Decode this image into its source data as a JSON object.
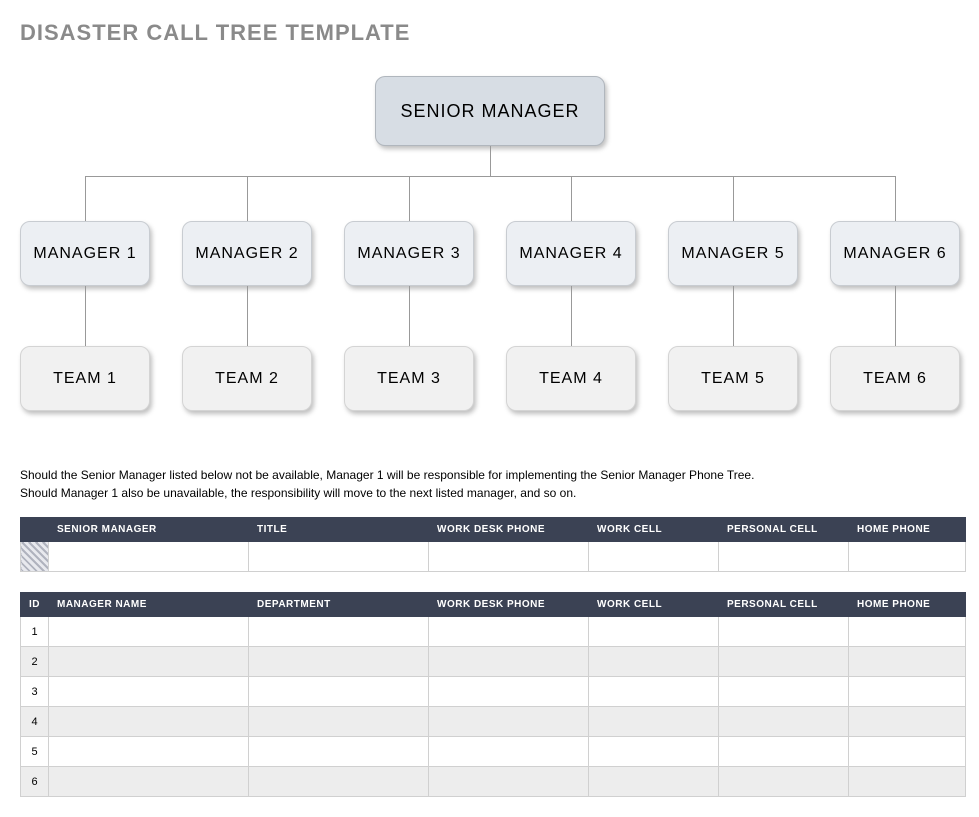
{
  "title": "DISASTER CALL TREE TEMPLATE",
  "tree": {
    "root": "SENIOR MANAGER",
    "managers": [
      "MANAGER 1",
      "MANAGER 2",
      "MANAGER 3",
      "MANAGER 4",
      "MANAGER 5",
      "MANAGER 6"
    ],
    "teams": [
      "TEAM 1",
      "TEAM 2",
      "TEAM 3",
      "TEAM 4",
      "TEAM 5",
      "TEAM 6"
    ]
  },
  "instructions": {
    "line1": "Should the Senior Manager listed below not be available, Manager 1 will be responsible for implementing the Senior Manager Phone Tree.",
    "line2": "Should Manager 1 also be unavailable, the responsibility will move to the next listed manager, and so on."
  },
  "senior_table": {
    "headers": [
      "SENIOR MANAGER",
      "TITLE",
      "WORK DESK PHONE",
      "WORK CELL",
      "PERSONAL CELL",
      "HOME PHONE"
    ],
    "row": [
      "",
      "",
      "",
      "",
      "",
      ""
    ]
  },
  "manager_table": {
    "headers": [
      "ID",
      "MANAGER NAME",
      "DEPARTMENT",
      "WORK DESK PHONE",
      "WORK CELL",
      "PERSONAL CELL",
      "HOME PHONE"
    ],
    "rows": [
      {
        "id": "1",
        "name": "",
        "dept": "",
        "desk": "",
        "wcell": "",
        "pcell": "",
        "home": ""
      },
      {
        "id": "2",
        "name": "",
        "dept": "",
        "desk": "",
        "wcell": "",
        "pcell": "",
        "home": ""
      },
      {
        "id": "3",
        "name": "",
        "dept": "",
        "desk": "",
        "wcell": "",
        "pcell": "",
        "home": ""
      },
      {
        "id": "4",
        "name": "",
        "dept": "",
        "desk": "",
        "wcell": "",
        "pcell": "",
        "home": ""
      },
      {
        "id": "5",
        "name": "",
        "dept": "",
        "desk": "",
        "wcell": "",
        "pcell": "",
        "home": ""
      },
      {
        "id": "6",
        "name": "",
        "dept": "",
        "desk": "",
        "wcell": "",
        "pcell": "",
        "home": ""
      }
    ]
  }
}
